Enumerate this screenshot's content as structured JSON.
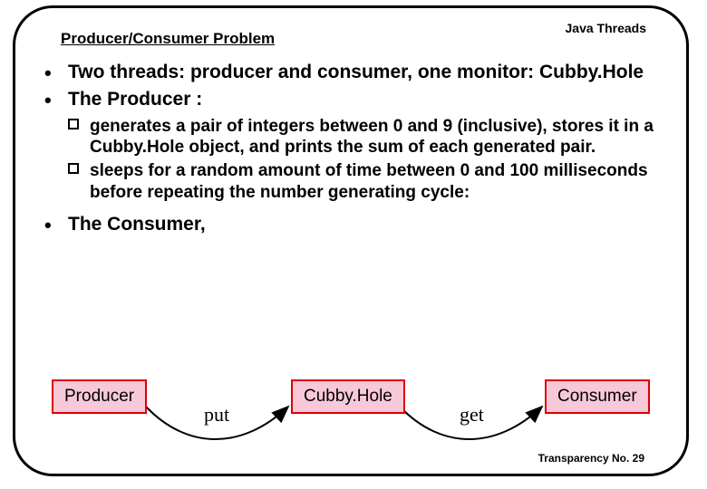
{
  "header": {
    "topic": "Java Threads",
    "subtitle": "Producer/Consumer Problem"
  },
  "bullets": {
    "b1": "Two threads: producer and consumer, one monitor: Cubby.Hole",
    "b2": "The Producer :",
    "b2a": "generates a pair of integers between 0 and 9 (inclusive), stores it in a Cubby.Hole object, and  prints the sum of each generated pair.",
    "b2b": " sleeps  for a random amount of time between 0 and 100 milliseconds before repeating the number generating cycle:",
    "b3": "The Consumer,"
  },
  "diagram": {
    "producer": "Producer",
    "cubby": "Cubby.Hole",
    "consumer": "Consumer",
    "put": "put",
    "get": "get"
  },
  "footer": {
    "transparency": "Transparency No. 29"
  }
}
